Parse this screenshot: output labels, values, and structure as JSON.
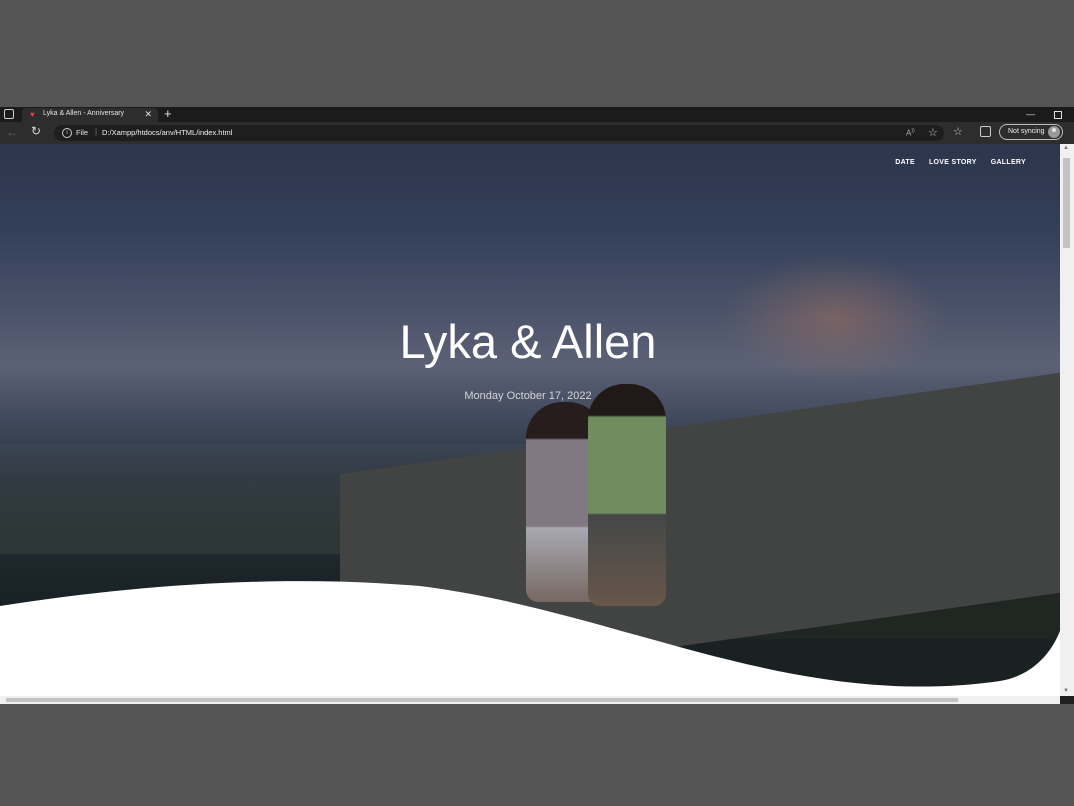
{
  "browser": {
    "tab": {
      "title": "Lyka & Allen - Anniversary"
    },
    "address": {
      "file_label": "File",
      "url": "D:/Xampp/htdocs/anv/HTML/index.html"
    },
    "sync_label": "Not syncing"
  },
  "site": {
    "nav": [
      "DATE",
      "LOVE STORY",
      "GALLERY"
    ],
    "title": "Lyka & Allen",
    "date": "Monday October 17, 2022"
  }
}
